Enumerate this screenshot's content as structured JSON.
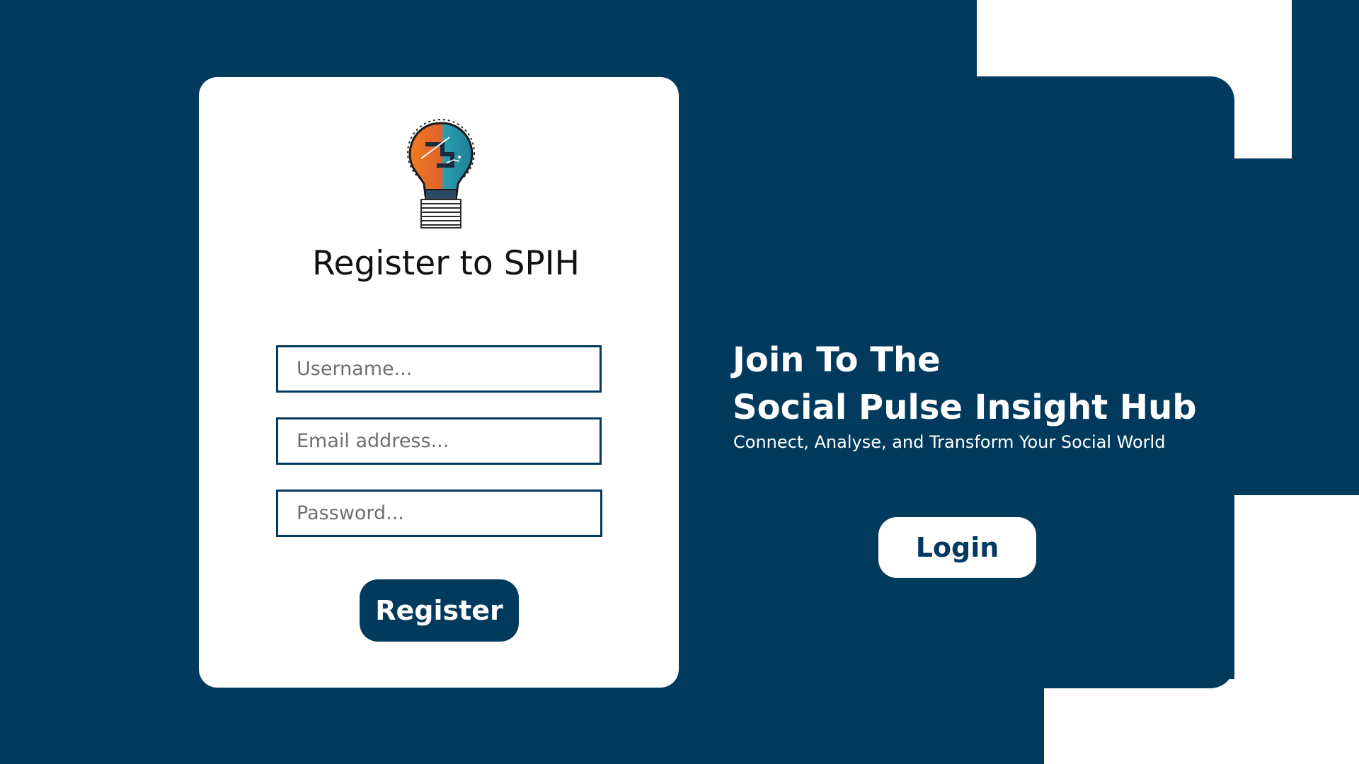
{
  "brand": {
    "primary_color": "#023a5e",
    "background_color": "#ffffff"
  },
  "register_card": {
    "logo_icon": "lightbulb-logo-icon",
    "title": "Register to SPIH",
    "username": {
      "value": "",
      "placeholder": "Username..."
    },
    "email": {
      "value": "",
      "placeholder": "Email address..."
    },
    "password": {
      "value": "",
      "placeholder": "Password..."
    },
    "register_label": "Register"
  },
  "promo": {
    "headline_line1": "Join To The",
    "headline_line2": "Social Pulse Insight Hub",
    "subtitle": "Connect, Analyse, and Transform Your Social World",
    "login_label": "Login"
  }
}
